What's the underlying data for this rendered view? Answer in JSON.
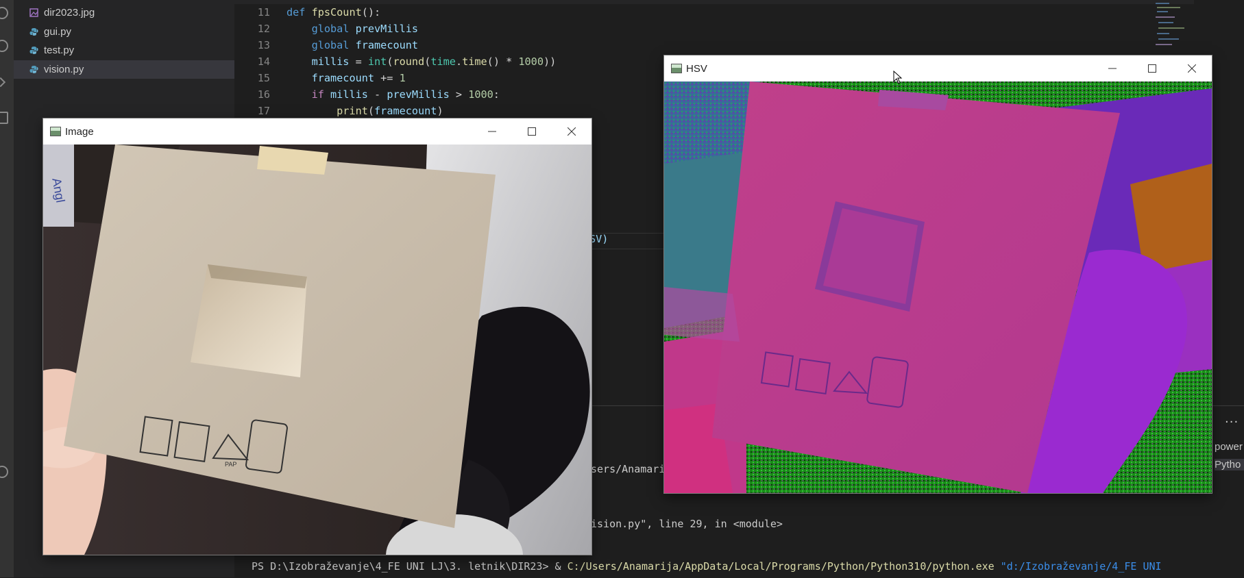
{
  "explorer": {
    "files": [
      {
        "name": "dir2023.jpg",
        "type": "image"
      },
      {
        "name": "gui.py",
        "type": "python"
      },
      {
        "name": "test.py",
        "type": "python"
      },
      {
        "name": "vision.py",
        "type": "python",
        "active": true
      }
    ]
  },
  "editor": {
    "lines": [
      {
        "num": "11"
      },
      {
        "num": "12"
      },
      {
        "num": "13"
      },
      {
        "num": "14"
      },
      {
        "num": "15"
      },
      {
        "num": "16"
      },
      {
        "num": "17"
      }
    ],
    "partial_code_sv": "SV)"
  },
  "terminal": {
    "fragment_users": "sers/Anamari",
    "fragment_vision": "ision.py\", line 29, in <module>",
    "prompt": "PS D:\\Izobraževanje\\4_FE UNI LJ\\3. letnik\\DIR23> ",
    "amp": "& ",
    "python_path": "C:/Users/Anamarija/AppData/Local/Programs/Python/Python310/python.exe",
    "script_path": " \"d:/Izobraževanje/4_FE UNI",
    "side_power": "power",
    "side_python": "Pytho",
    "more": "···"
  },
  "windows": {
    "image": {
      "title": "Image"
    },
    "hsv": {
      "title": "HSV"
    }
  },
  "colors": {
    "python_icon": "#519aba",
    "image_icon": "#a074c4"
  }
}
